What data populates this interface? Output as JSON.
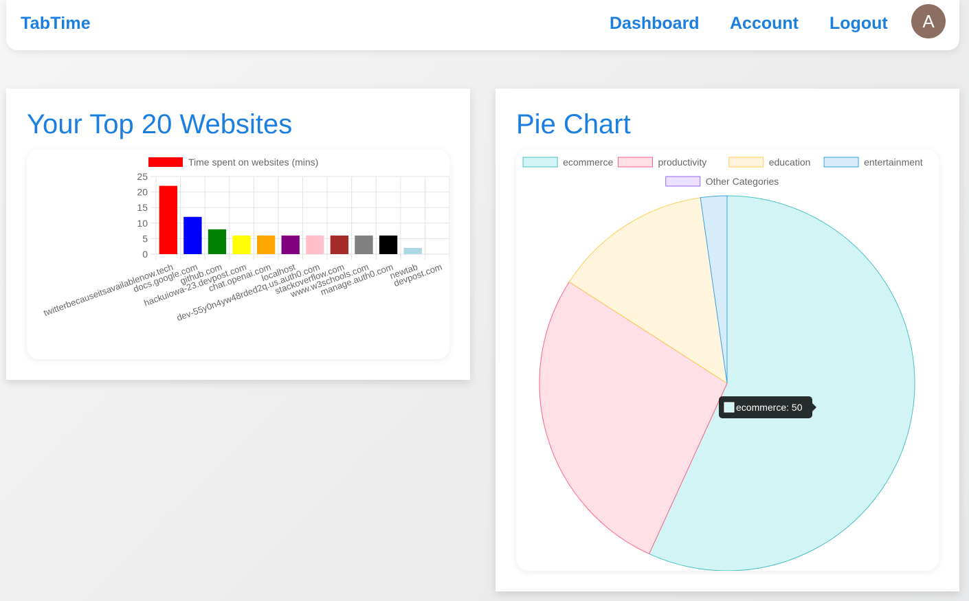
{
  "nav": {
    "brand": "TabTime",
    "links": [
      "Dashboard",
      "Account",
      "Logout"
    ],
    "avatar_letter": "A",
    "brand_color": "#1a7fe0",
    "avatar_color": "#8d6e63"
  },
  "bar_card": {
    "title": "Your Top 20 Websites"
  },
  "pie_card": {
    "title": "Pie Chart"
  },
  "chart_data": [
    {
      "type": "bar",
      "legend": [
        "Time spent on websites (mins)"
      ],
      "legend_position": "top",
      "categories": [
        "twitterbecauseitsavailablenow.tech",
        "docs.google.com",
        "github.com",
        "hackuiowa-23.devpost.com",
        "chat.openai.com",
        "localhost",
        "dev-55y0n4yw48rded2q.us.auth0.com",
        "stackoverflow.com",
        "www.w3schools.com",
        "manage.auth0.com",
        "newtab",
        "devpost.com"
      ],
      "values": [
        22,
        12,
        8,
        6,
        6,
        6,
        6,
        6,
        6,
        6,
        2,
        0
      ],
      "colors": [
        "#ff0000",
        "#0000ff",
        "#008000",
        "#ffff00",
        "#ffa500",
        "#800080",
        "#ffc0cb",
        "#a52a2a",
        "#808080",
        "#000000",
        "#add8e6",
        "#ffffff"
      ],
      "ylim": [
        0,
        25
      ],
      "yticks": [
        "0",
        "5",
        "10",
        "15",
        "20",
        "25"
      ],
      "grid": true
    },
    {
      "type": "pie",
      "legend_position": "top",
      "labels": [
        "ecommerce",
        "productivity",
        "education",
        "entertainment",
        "Other Categories"
      ],
      "values": [
        50,
        24,
        12,
        2,
        0
      ],
      "fill_colors": [
        "#d3f4f4",
        "#ffe0e6",
        "#fff5dd",
        "#d7ecfb",
        "#ebe0ff"
      ],
      "border_colors": [
        "#4bc0c0",
        "#ff6384",
        "#ffcd56",
        "#36a2eb",
        "#9966ff"
      ],
      "tooltip": {
        "label": "ecommerce: 50"
      }
    }
  ]
}
